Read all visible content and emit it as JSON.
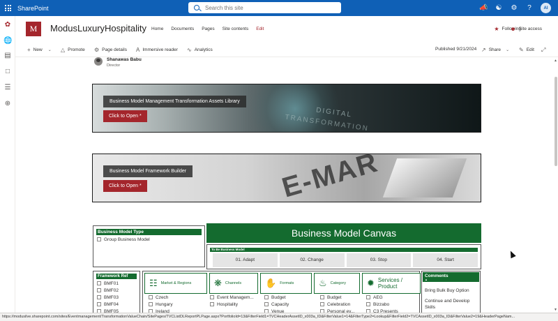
{
  "suitebar": {
    "brand": "SharePoint",
    "search_placeholder": "Search this site",
    "icons": [
      "megaphone-icon",
      "share-icon",
      "settings-icon",
      "help-icon"
    ],
    "avatar_initials": "AI",
    "color": "#0f60b6"
  },
  "site": {
    "logo_letter": "M",
    "title": "ModusLuxuryHospitality",
    "nav": [
      "Home",
      "Documents",
      "Pages",
      "Site contents",
      "Edit"
    ],
    "follow_label": "Following",
    "access_label": "Site access",
    "accent": "#a4262c"
  },
  "cmdbar": {
    "new_label": "New",
    "promote_label": "Promote",
    "page_details_label": "Page details",
    "immersive_label": "Immersive reader",
    "analytics_label": "Analytics",
    "published_label": "Published 9/21/2024",
    "share_label": "Share",
    "edit_label": "Edit"
  },
  "author": {
    "name": "Shanawas Babu",
    "role": "Director"
  },
  "banners": [
    {
      "label": "Business Model Management Transformation Assets Library",
      "button": "Click to Open *",
      "art_words": [
        "DIGITAL",
        "TRANSFORMATION"
      ]
    },
    {
      "label": "Business Model Framework Builder",
      "button": "Click to Open *",
      "art_text": "E-MAR"
    }
  ],
  "bm_type": {
    "header": "Business Model Type",
    "items": [
      "Group Business Model"
    ]
  },
  "canvas": {
    "title": "Business Model Canvas",
    "stage_header": "To Be Business Model",
    "stages": [
      "01. Adapt",
      "02. Change",
      "03. Stop",
      "04. Start"
    ],
    "green": "#146b2f"
  },
  "framework_ref": {
    "header": "Framework Ref",
    "items": [
      "BMF01",
      "BMF02",
      "BMF03",
      "BMF04",
      "BMF05"
    ]
  },
  "categories": [
    {
      "label": "Market & Regions",
      "icon": "market-icon",
      "items": [
        "Czech",
        "Hungary",
        "Ireland"
      ]
    },
    {
      "label": "Channels",
      "icon": "channels-icon",
      "items": [
        "Event Managem...",
        "Hospitality"
      ]
    },
    {
      "label": "Formats",
      "icon": "formats-icon",
      "items": [
        "Budget",
        "Capacity",
        "Venue"
      ]
    },
    {
      "label": "Category",
      "icon": "category-icon",
      "items": [
        "Budget",
        "Celebration",
        "Personal ev..."
      ]
    },
    {
      "label": "Services / Product",
      "icon": "services-icon",
      "items": [
        "AEG",
        "Bizzabo",
        "C3 Presents"
      ]
    }
  ],
  "comments": {
    "header": "Comments",
    "items": [
      "Bring Bulk Buy Option",
      "Continue and Develop Skills"
    ]
  },
  "statusbar": {
    "url": "https://modusilve.sharepoint.com/sites/Eventmanagement/TransformationValueChain/SitePages/TVCListDLReportPLPage.aspx?PortfolioId=13&FilterField1=TVCHeaderAssetID_x003a_ID&FilterValue1=14&FilterType2=Lookup&FilterField2=TVCAssetID_x003a_ID&FilterValue2=19&HeaderPageNam..."
  }
}
